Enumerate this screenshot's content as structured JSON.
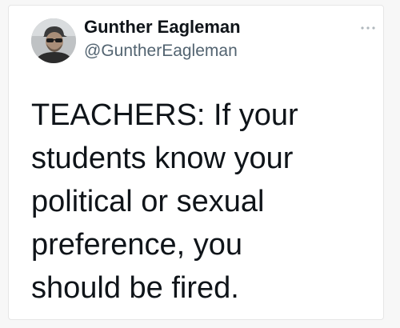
{
  "tweet": {
    "author": {
      "display_name": "Gunther Eagleman",
      "handle": "@GuntherEagleman",
      "avatar_icon": "user-avatar"
    },
    "more_icon": "more-horizontal-icon",
    "text": "TEACHERS: If your\nstudents know your\npolitical or sexual\npreference, you\nshould be fired."
  },
  "colors": {
    "text_primary": "#0f1419",
    "text_secondary": "#536471",
    "card_background": "#ffffff"
  }
}
